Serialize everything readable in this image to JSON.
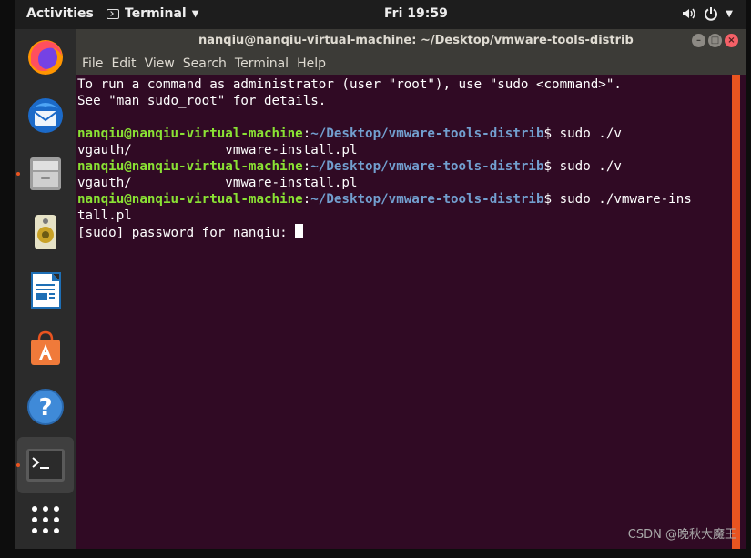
{
  "topbar": {
    "activities": "Activities",
    "app_menu_label": "Terminal",
    "clock": "Fri 19:59"
  },
  "dock": {
    "items": [
      {
        "name": "firefox-icon"
      },
      {
        "name": "thunderbird-icon"
      },
      {
        "name": "files-icon"
      },
      {
        "name": "rhythmbox-icon"
      },
      {
        "name": "libreoffice-writer-icon"
      },
      {
        "name": "software-center-icon"
      },
      {
        "name": "help-icon"
      },
      {
        "name": "terminal-icon"
      },
      {
        "name": "show-applications-icon"
      }
    ]
  },
  "window": {
    "title": "nanqiu@nanqiu-virtual-machine: ~/Desktop/vmware-tools-distrib",
    "menu": [
      "File",
      "Edit",
      "View",
      "Search",
      "Terminal",
      "Help"
    ]
  },
  "terminal": {
    "intro_1": "To run a command as administrator (user \"root\"), use \"sudo <command>\".",
    "intro_2": "See \"man sudo_root\" for details.",
    "user_host": "nanqiu@nanqiu-virtual-machine",
    "sep": ":",
    "path": "~/Desktop/vmware-tools-distrib",
    "cmd_1": "$ sudo ./v",
    "completion_1": "vgauth/            vmware-install.pl",
    "cmd_2": "$ sudo ./v",
    "completion_2": "vgauth/            vmware-install.pl",
    "cmd_3": "$ sudo ./vmware-ins",
    "cmd_3_wrap": "tall.pl",
    "password_prompt": "[sudo] password for nanqiu: "
  },
  "watermark": "CSDN @晚秋大魔王"
}
